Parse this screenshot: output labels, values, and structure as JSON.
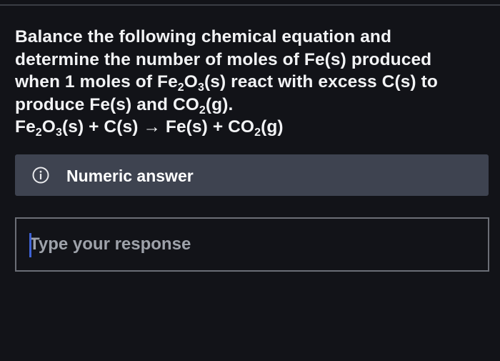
{
  "question": {
    "line1": "Balance the following chemical equation and",
    "line2": "determine the number of moles of Fe(s) produced",
    "line3_a": "when 1 moles of Fe",
    "line3_sub1": "2",
    "line3_b": "O",
    "line3_sub2": "3",
    "line3_c": "(s) react with excess C(s) to",
    "line4_a": "produce Fe(s) and CO",
    "line4_sub": "2",
    "line4_b": "(g).",
    "eq_a": "Fe",
    "eq_sub1": "2",
    "eq_b": "O",
    "eq_sub2": "3",
    "eq_c": "(s) + C(s) → Fe(s) + CO",
    "eq_sub3": "2",
    "eq_d": "(g)"
  },
  "hint": {
    "label": "Numeric answer",
    "icon": "info-icon"
  },
  "response": {
    "placeholder": "Type your response",
    "value": ""
  }
}
